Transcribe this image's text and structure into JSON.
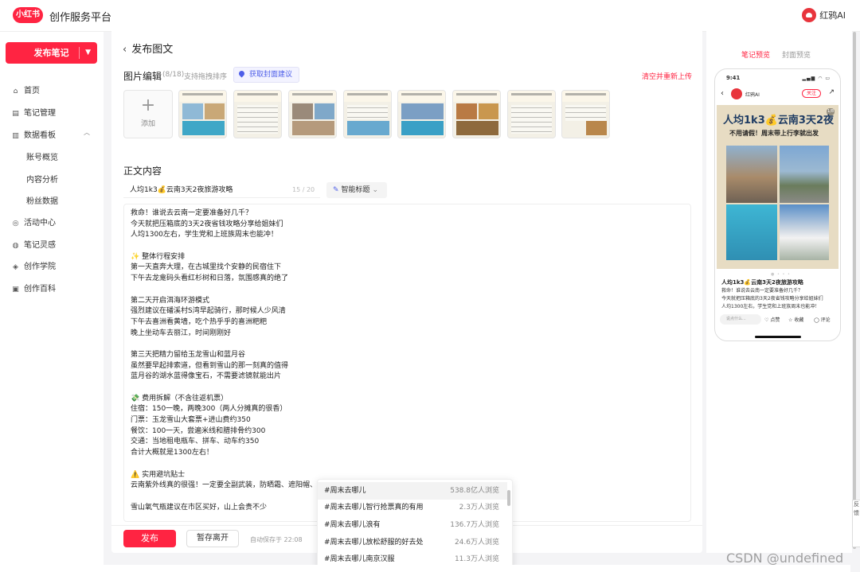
{
  "topbar": {
    "logo": "小红书",
    "platform": "创作服务平台",
    "user": "红鸦AI"
  },
  "sidebar": {
    "publish": "发布笔记",
    "items": [
      {
        "label": "首页",
        "icon": "home-icon"
      },
      {
        "label": "笔记管理",
        "icon": "note-icon"
      },
      {
        "label": "数据看板",
        "icon": "chart-icon"
      },
      {
        "label": "活动中心",
        "icon": "activity-icon"
      },
      {
        "label": "笔记灵感",
        "icon": "bulb-icon"
      },
      {
        "label": "创作学院",
        "icon": "academy-icon"
      },
      {
        "label": "创作百科",
        "icon": "book-icon"
      }
    ],
    "sub": [
      "账号概览",
      "内容分析",
      "粉丝数据"
    ]
  },
  "main": {
    "back_title": "发布图文",
    "image_section": "图片编辑",
    "count": "(8/18)",
    "drag_hint": "支持拖拽排序",
    "cover_btn": "获取封面建议",
    "clear": "清空并重新上传",
    "add_label": "添加",
    "body_label": "正文内容",
    "title_value": "人均1k3💰云南3天2夜旅游攻略",
    "title_count": "15 / 20",
    "smart_title": "智能标题",
    "editor_lines": [
      "救命！谁说去云南一定要准备好几千？",
      "今天就把压箱底的3天2夜省钱攻略分享给姐妹们",
      "人均1300左右，学生党和上班族周末也能冲！",
      "",
      "✨ 整体行程安排",
      "第一天直奔大理，在古城里找个安静的民宿住下",
      "下午去龙龛码头看红杉树和日落，氛围感真的绝了",
      "",
      "第二天开启洱海环游模式",
      "强烈建议在磻溪村S湾早起骑行，那时候人少风清",
      "下午去喜洲看黄墙，吃个热乎乎的喜洲粑粑",
      "晚上坐动车去丽江，时间刚刚好",
      "",
      "第三天把精力留给玉龙雪山和蓝月谷",
      "虽然要早起排索道，但看到雪山的那一刻真的值得",
      "蓝月谷的湖水蓝得像宝石，不需要滤镜就能出片",
      "",
      "💸 费用拆解（不含往返机票）",
      "住宿：150一晚，两晚300（两人分摊真的很香）",
      "门票：玉龙雪山大套票+进山费约350",
      "餐饮：100一天，尝遍米线和腊排骨约300",
      "交通：当地租电瓶车、拼车、动车约350",
      "合计大概就是1300左右！",
      "",
      "⚠️ 实用避坑贴士",
      "云南紫外线真的很强！一定要全副武装，防晒霜、遮阳帽、墨",
      "",
      "雪山氧气瓶建议在市区买好，山上会贵不少"
    ],
    "publish": "发布",
    "draft": "暂存离开",
    "autosave": "自动保存于 22:08"
  },
  "hashtags": [
    {
      "tag": "#周末去哪儿",
      "views": "538.8亿人浏览"
    },
    {
      "tag": "#周末去哪儿智行抢票真的有用",
      "views": "2.3万人浏览"
    },
    {
      "tag": "#周末去哪儿浪有",
      "views": "136.7万人浏览"
    },
    {
      "tag": "#周末去哪儿放松舒服的好去处",
      "views": "24.6万人浏览"
    },
    {
      "tag": "#周末去哪儿南京汉服",
      "views": "11.3万人浏览"
    }
  ],
  "preview": {
    "tab_note": "笔记预览",
    "tab_cover": "封面预览",
    "time": "9:41",
    "status": "▂▄▆ ◠ ▭",
    "author": "红鸦AI",
    "follow": "关注",
    "cover_title": "人均1k3💰云南3天2夜",
    "cover_sub": "不用请假！周末带上行李就出发",
    "page": "1/8",
    "title": "人均1k3💰云南3天2夜旅游攻略",
    "desc": [
      "救命！谁说去云南一定要准备好几千？",
      "今天就把压箱底的3天2夜省钱攻略分享给姐妹们",
      "人均1300左右，学生党和上班族周末也能冲！"
    ],
    "say": "说点什么...",
    "like": "点赞",
    "fav": "收藏",
    "comment": "评论"
  },
  "side_float": "反馈",
  "watermark": "CSDN @undefined"
}
